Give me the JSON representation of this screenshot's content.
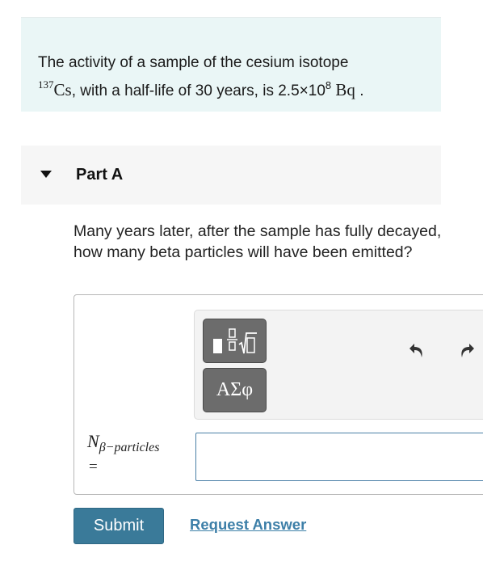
{
  "intro": {
    "text_before": "The activity of a sample of the cesium isotope",
    "isotope_mass_number": "137",
    "isotope_symbol": "Cs",
    "text_mid": ", with a half-life of 30 years, is 2.5×10",
    "exponent": "8",
    "unit": "Bq",
    "text_end": "."
  },
  "part": {
    "title": "Part A"
  },
  "question": {
    "text": "Many years later, after the sample has fully decayed, how many beta particles will have been emitted?"
  },
  "toolbar": {
    "greek_label": "ΑΣφ"
  },
  "answer": {
    "variable_symbol": "N",
    "variable_subscript": "β−particles",
    "equals": "=",
    "value": ""
  },
  "actions": {
    "submit_label": "Submit",
    "request_label": "Request Answer"
  },
  "colors": {
    "intro_bg": "#eaf6f6",
    "submit_bg": "#3a7a99",
    "link": "#3d7fa8"
  }
}
